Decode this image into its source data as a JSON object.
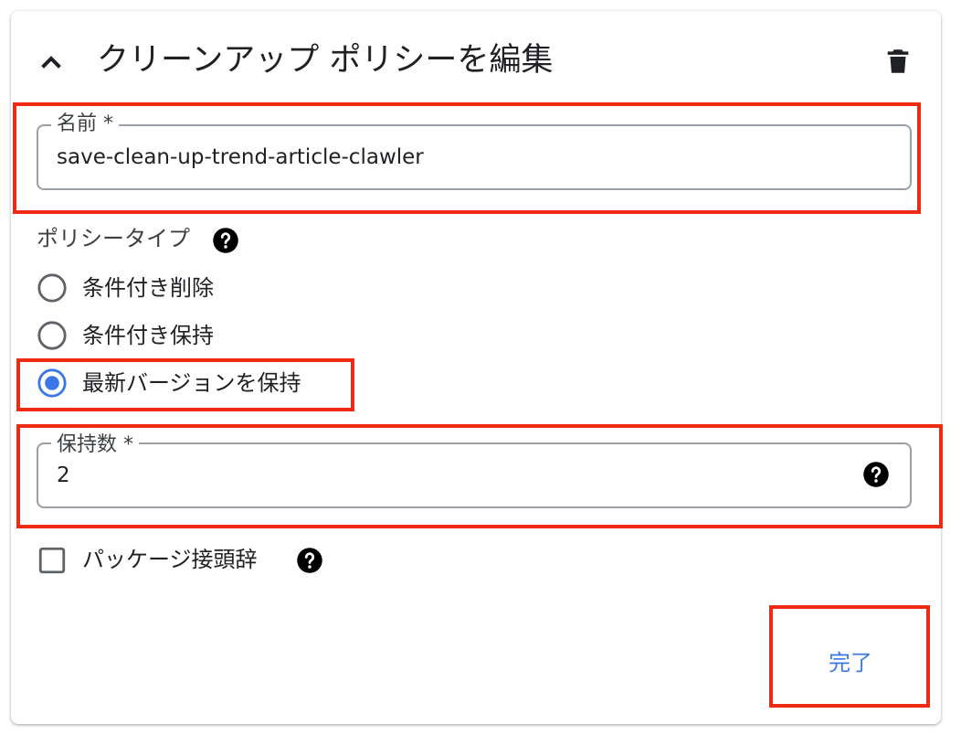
{
  "header": {
    "title": "クリーンアップ ポリシーを編集",
    "collapse_icon": "chevron-up-icon",
    "delete_icon": "trash-icon"
  },
  "name_field": {
    "label": "名前 *",
    "value": "save-clean-up-trend-article-clawler"
  },
  "policy_type": {
    "label": "ポリシータイプ",
    "help_icon": "help-icon",
    "options": [
      {
        "label": "条件付き削除",
        "selected": false
      },
      {
        "label": "条件付き保持",
        "selected": false
      },
      {
        "label": "最新バージョンを保持",
        "selected": true
      }
    ]
  },
  "keep_count_field": {
    "label": "保持数 *",
    "value": "2",
    "help_icon": "help-icon"
  },
  "package_prefix": {
    "label": "パッケージ接頭辞",
    "checked": false,
    "help_icon": "help-icon"
  },
  "done_button": {
    "label": "完了"
  },
  "colors": {
    "accent": "#3b78e7",
    "highlight_box": "#ee2a12",
    "text": "#202124",
    "border": "#9aa0a6"
  }
}
